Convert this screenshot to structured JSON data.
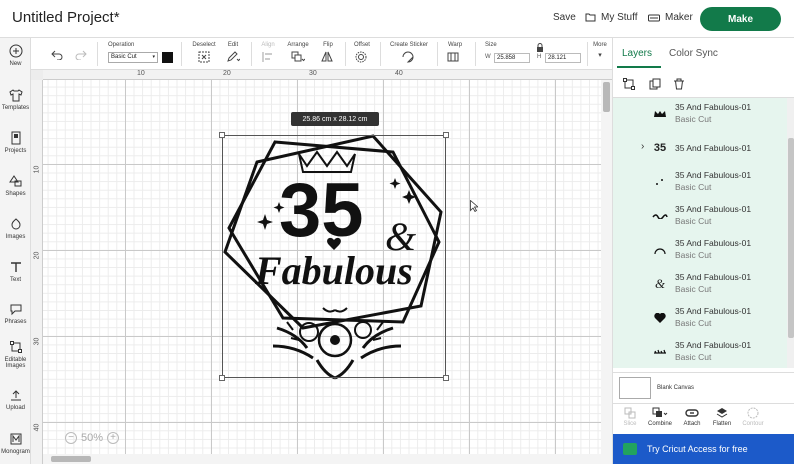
{
  "header": {
    "project_title": "Untitled Project*",
    "save_label": "Save",
    "my_stuff_label": "My Stuff",
    "maker_label": "Maker",
    "make_label": "Make",
    "make_color": "#127a4a"
  },
  "leftnav": {
    "items": [
      {
        "label": "New",
        "icon": "plus-circle-icon"
      },
      {
        "label": "Templates",
        "icon": "shirt-icon"
      },
      {
        "label": "Projects",
        "icon": "projects-icon"
      },
      {
        "label": "Shapes",
        "icon": "shapes-icon"
      },
      {
        "label": "Images",
        "icon": "images-icon"
      },
      {
        "label": "Text",
        "icon": "text-icon"
      },
      {
        "label": "Phrases",
        "icon": "speech-bubble-icon"
      },
      {
        "label": "Editable Images",
        "icon": "editable-images-icon"
      },
      {
        "label": "Upload",
        "icon": "upload-icon"
      },
      {
        "label": "Monogram",
        "icon": "monogram-icon"
      }
    ]
  },
  "toolbar": {
    "operation_label": "Operation",
    "operation_value": "Basic Cut",
    "deselect_label": "Deselect",
    "edit_label": "Edit",
    "align_label": "Align",
    "arrange_label": "Arrange",
    "flip_label": "Flip",
    "offset_label": "Offset",
    "create_sticker_label": "Create Sticker",
    "warp_label": "Warp",
    "size_label": "Size",
    "width_label": "W",
    "width_value": "25.858",
    "height_label": "H",
    "height_value": "28.121",
    "more_label": "More"
  },
  "canvas": {
    "ruler_top": [
      "10",
      "20",
      "30",
      "40"
    ],
    "ruler_left": [
      "10",
      "20",
      "30",
      "40"
    ],
    "size_tooltip": "25.86  cm x 28.12  cm",
    "zoom_level": "50%",
    "zoom_out": "−",
    "zoom_in": "+",
    "design_number": "35",
    "design_ampersand": "&",
    "design_word": "Fabulous"
  },
  "right_panel": {
    "tab_layers": "Layers",
    "tab_color_sync": "Color Sync",
    "layers": [
      {
        "name": "35 And Fabulous-01",
        "sub": "Basic Cut",
        "thumb": "crown-icon",
        "expandable": false
      },
      {
        "name": "35 And Fabulous-01",
        "sub": "",
        "thumb": "number-35-icon",
        "expandable": true,
        "thumb_text": "35"
      },
      {
        "name": "35 And Fabulous-01",
        "sub": "Basic Cut",
        "thumb": "dots-icon",
        "expandable": false
      },
      {
        "name": "35 And Fabulous-01",
        "sub": "Basic Cut",
        "thumb": "script-word-icon",
        "expandable": false
      },
      {
        "name": "35 And Fabulous-01",
        "sub": "Basic Cut",
        "thumb": "arc-icon",
        "expandable": false
      },
      {
        "name": "35 And Fabulous-01",
        "sub": "Basic Cut",
        "thumb": "ampersand-icon",
        "expandable": false,
        "thumb_text": "&"
      },
      {
        "name": "35 And Fabulous-01",
        "sub": "Basic Cut",
        "thumb": "heart-icon",
        "expandable": false
      },
      {
        "name": "35 And Fabulous-01",
        "sub": "Basic Cut",
        "thumb": "floral-icon",
        "expandable": false
      }
    ],
    "blank_canvas_label": "Blank Canvas",
    "bottom_tools": [
      {
        "label": "Slice",
        "icon": "slice-icon",
        "enabled": false
      },
      {
        "label": "Combine",
        "icon": "combine-icon",
        "enabled": true
      },
      {
        "label": "Attach",
        "icon": "attach-icon",
        "enabled": true
      },
      {
        "label": "Flatten",
        "icon": "flatten-icon",
        "enabled": true
      },
      {
        "label": "Contour",
        "icon": "contour-icon",
        "enabled": false
      }
    ],
    "access_label": "Try Cricut Access for free",
    "access_color": "#1c5ac9"
  }
}
